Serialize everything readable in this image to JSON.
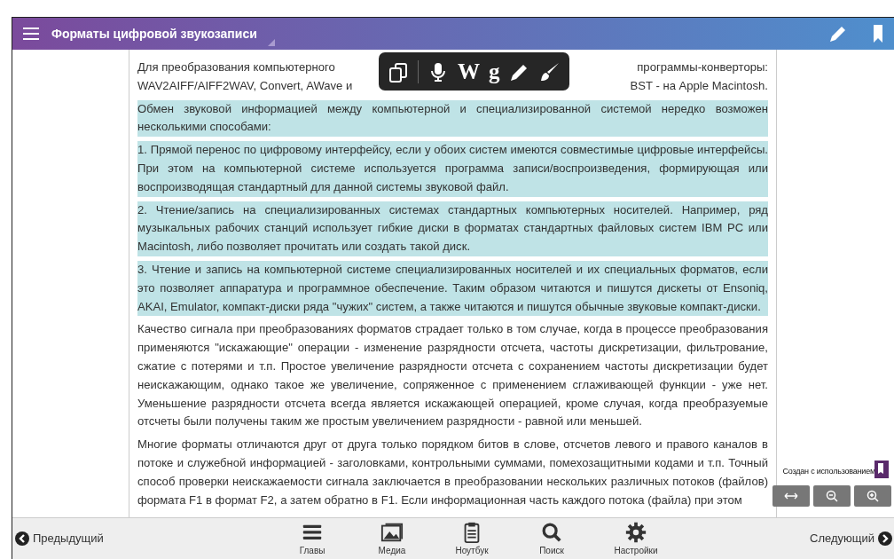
{
  "header": {
    "title": "Форматы цифровой звукозаписи"
  },
  "selection_toolbar": [
    {
      "kind": "copy"
    },
    {
      "kind": "mic"
    },
    {
      "kind": "letter",
      "text": "W"
    },
    {
      "kind": "letter",
      "text": "g"
    },
    {
      "kind": "pencil"
    },
    {
      "kind": "brush"
    }
  ],
  "paragraphs": [
    {
      "kind": "partly_covered",
      "lines": [
        [
          "Для преобразования компьютерного",
          "программы-конверторы:"
        ],
        [
          "WAV2AIFF/AIFF2WAV, Convert, AWave и",
          "BST - на Apple Macintosh."
        ]
      ],
      "highlighted": false
    },
    {
      "text": "Обмен звуковой информацией между компьютерной и специализированной системой нередко возможен несколькими способами:",
      "highlighted": true
    },
    {
      "text": "1. Прямой перенос по цифровому интерфейсу, если у обоих систем имеются совместимые цифровые интерфейсы. При этом на компьютерной системе используется программа записи/воспроизведения, формирующая или воспроизводящая стандартный для данной системы звуковой файл.",
      "highlighted": true
    },
    {
      "text": "2. Чтение/запись на специализированных системах стандартных компьютерных носителей. Например, ряд музыкальных рабочих станций использует гибкие диски в форматах стандартных файловых систем IBM PC или Macintosh, либо позволяет прочитать или создать такой диск.",
      "highlighted": true
    },
    {
      "text": "3. Чтение и запись на компьютерной системе специализированных носителей и их специальных форматов, если это позволяет аппаратура и программное обеспечение. Таким образом читаются и пишутся дискеты от Ensoniq, AKAI, Emulator, компакт-диски ряда \"чужих\" систем, а также читаются и пишутся обычные звуковые компакт-диски.",
      "highlighted": true
    },
    {
      "text": "Качество сигнала при преобразованиях форматов страдает только в том случае, когда в процессе преобразования применяются \"искажающие\" операции - изменение разрядности отсчета, частоты дискретизации, фильтрование, сжатие с потерями и т.п. Простое увеличение разрядности отсчета с сохранением частоты дискретизации будет неискажающим, однако такое же увеличение, сопряженное с применением сглаживающей функции - уже нет. Уменьшение разрядности отсчета всегда является искажающей операцией, кроме случая, когда преобразуемые отсчеты были получены таким же простым увеличением разрядности - равной или меньшей.",
      "highlighted": false
    },
    {
      "text": "Многие форматы отличаются друг от друга только порядком битов в слове, отсчетов левого и правого каналов в потоке и служебной информацией - заголовками, контрольными суммами, помехозащитными кодами и т.п. Точный способ проверки неискажаемости сигнала заключается в преобразовании нескольких различных потоков (файлов) формата F1 в формат F2, а затем обратно в F1. Если информационная часть каждого потока (файла) при этом",
      "highlighted": false
    }
  ],
  "credit": "Создан с использованием",
  "footer": {
    "previous": "Предыдущий",
    "next": "Следующий",
    "tabs": [
      {
        "kind": "chapters",
        "label": "Главы"
      },
      {
        "kind": "media",
        "label": "Медиа"
      },
      {
        "kind": "notebook",
        "label": "Ноутбук"
      },
      {
        "kind": "search",
        "label": "Поиск"
      },
      {
        "kind": "settings",
        "label": "Настройки"
      }
    ]
  }
}
